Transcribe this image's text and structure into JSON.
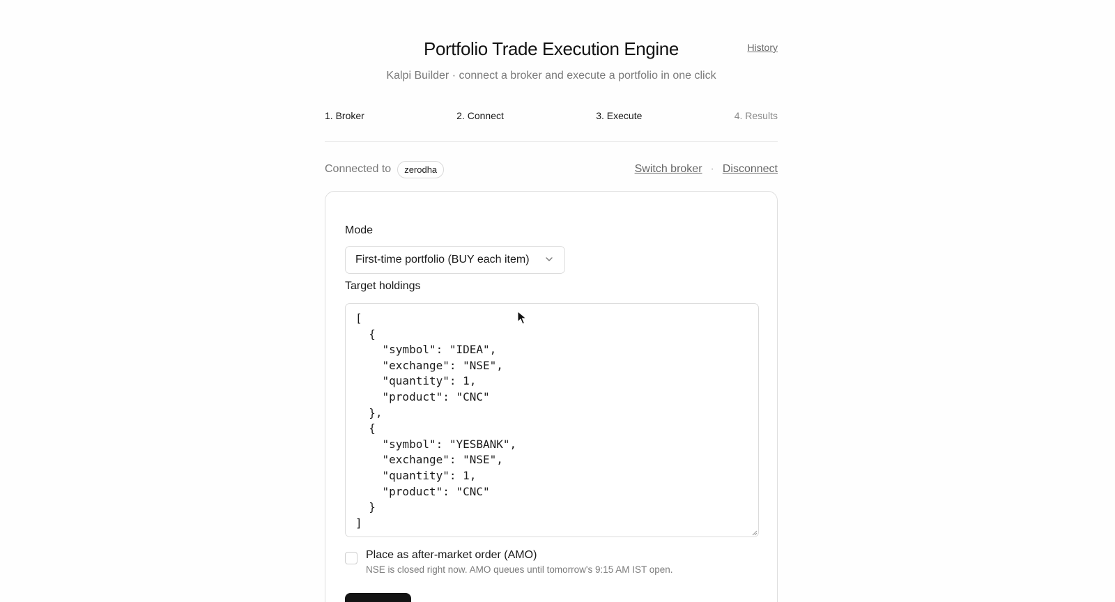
{
  "header": {
    "title": "Portfolio Trade Execution Engine",
    "subtitle": "Kalpi Builder · connect a broker and execute a portfolio in one click",
    "history_link": "History"
  },
  "steps": [
    {
      "label": "1. Broker",
      "state": "done"
    },
    {
      "label": "2. Connect",
      "state": "done"
    },
    {
      "label": "3. Execute",
      "state": "active"
    },
    {
      "label": "4. Results",
      "state": "pending"
    }
  ],
  "connection": {
    "prefix": "Connected to",
    "broker": "zerodha",
    "switch_label": "Switch broker",
    "separator": "·",
    "disconnect_label": "Disconnect"
  },
  "form": {
    "mode_label": "Mode",
    "mode_value": "First-time portfolio (BUY each item)",
    "holdings_label": "Target holdings",
    "holdings_json": "[\n  {\n    \"symbol\": \"IDEA\",\n    \"exchange\": \"NSE\",\n    \"quantity\": 1,\n    \"product\": \"CNC\"\n  },\n  {\n    \"symbol\": \"YESBANK\",\n    \"exchange\": \"NSE\",\n    \"quantity\": 1,\n    \"product\": \"CNC\"\n  }\n]",
    "amo_label": "Place as after-market order (AMO)",
    "amo_help": "NSE is closed right now. AMO queues until tomorrow's 9:15 AM IST open.",
    "amo_checked": false
  },
  "icons": {
    "select": "chevron-down-icon",
    "textarea_resize": "resize-handle-icon",
    "pointer": "mouse-cursor-icon"
  }
}
